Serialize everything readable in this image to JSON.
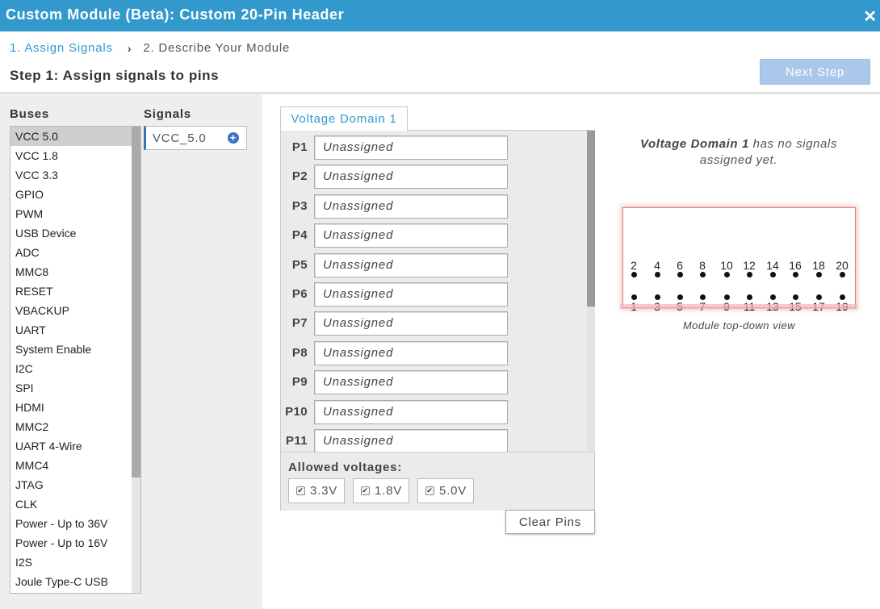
{
  "window": {
    "title": "Custom Module (Beta): Custom 20-Pin Header",
    "close_icon": "close-icon"
  },
  "wizard": {
    "step1": "1. Assign Signals",
    "step2": "2. Describe Your Module"
  },
  "step_title": "Step 1: Assign signals to pins",
  "next_button": "Next Step",
  "buses": {
    "label": "Buses",
    "selected": "VCC 5.0",
    "items": [
      "VCC 5.0",
      "VCC 1.8",
      "VCC 3.3",
      "GPIO",
      "PWM",
      "USB Device",
      "ADC",
      "MMC8",
      "RESET",
      "VBACKUP",
      "UART",
      "System Enable",
      "I2C",
      "SPI",
      "HDMI",
      "MMC2",
      "UART 4-Wire",
      "MMC4",
      "JTAG",
      "CLK",
      "Power - Up to 36V",
      "Power - Up to 16V",
      "I2S",
      "Joule Type-C USB"
    ]
  },
  "signals": {
    "label": "Signals",
    "items": [
      "VCC_5.0"
    ],
    "add_icon": "plus-circle-icon"
  },
  "voltage_domain": {
    "tab": "Voltage Domain 1",
    "pins": [
      {
        "label": "P1",
        "value": "Unassigned"
      },
      {
        "label": "P2",
        "value": "Unassigned"
      },
      {
        "label": "P3",
        "value": "Unassigned"
      },
      {
        "label": "P4",
        "value": "Unassigned"
      },
      {
        "label": "P5",
        "value": "Unassigned"
      },
      {
        "label": "P6",
        "value": "Unassigned"
      },
      {
        "label": "P7",
        "value": "Unassigned"
      },
      {
        "label": "P8",
        "value": "Unassigned"
      },
      {
        "label": "P9",
        "value": "Unassigned"
      },
      {
        "label": "P10",
        "value": "Unassigned"
      },
      {
        "label": "P11",
        "value": "Unassigned"
      }
    ],
    "allowed_label": "Allowed voltages:",
    "voltages": [
      {
        "label": "3.3V",
        "checked": true
      },
      {
        "label": "1.8V",
        "checked": true
      },
      {
        "label": "5.0V",
        "checked": true
      }
    ],
    "clear_button": "Clear Pins"
  },
  "message": {
    "domain_name": "Voltage Domain 1",
    "rest": " has no signals assigned yet."
  },
  "module_view": {
    "top_row": [
      "2",
      "4",
      "6",
      "8",
      "10",
      "12",
      "14",
      "16",
      "18",
      "20"
    ],
    "bottom_row": [
      "1",
      "3",
      "5",
      "7",
      "9",
      "11",
      "13",
      "15",
      "17",
      "19"
    ],
    "caption": "Module top-down view"
  },
  "colors": {
    "title_bar": "#3399cc",
    "accent": "#3399cc",
    "next_button": "#a9c8ea",
    "signal_accent": "#3b72c4",
    "module_border": "#e07a7a"
  }
}
